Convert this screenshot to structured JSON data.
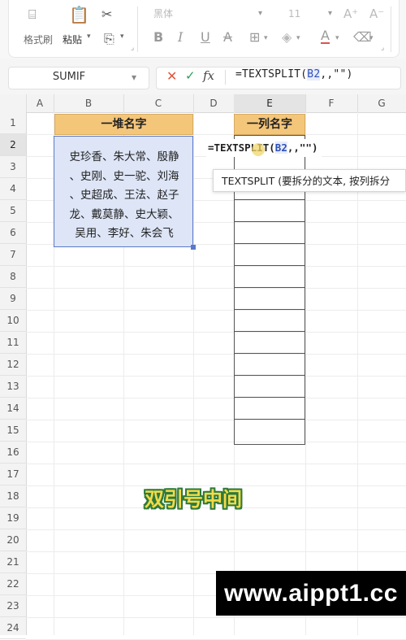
{
  "ribbon": {
    "format_painter_label": "格式刷",
    "paste_label": "粘贴",
    "font_name": "黑体",
    "font_size": "11",
    "increase_font_label": "A⁺",
    "decrease_font_label": "A⁻",
    "bold_label": "B",
    "italic_label": "I",
    "underline_label": "U",
    "strike_label": "A",
    "font_color_label": "A",
    "dropdown_arrow": "▾"
  },
  "formula_bar": {
    "name_box": "SUMIF",
    "fx_label": "fx",
    "cancel_symbol": "✕",
    "confirm_symbol": "✓",
    "formula_prefix": "=TEXTSPLIT(",
    "formula_ref": "B2",
    "formula_suffix": ",,\"\")"
  },
  "sheet": {
    "columns": [
      "A",
      "B",
      "C",
      "D",
      "E",
      "F",
      "G"
    ],
    "rows": [
      "1",
      "2",
      "3",
      "4",
      "5",
      "6",
      "7",
      "8",
      "9",
      "10",
      "11",
      "12",
      "13",
      "14",
      "15",
      "16",
      "17",
      "18",
      "19",
      "20",
      "21",
      "22",
      "23",
      "24"
    ],
    "b1_header": "一堆名字",
    "e1_header": "一列名字",
    "b2_lines": [
      "史珍香、朱大常、殷静",
      "、史刚、史一驼、刘海",
      "、史超成、王法、赵子",
      "龙、戴莫静、史大颖、",
      "吴用、李好、朱会飞"
    ],
    "edit_prefix": "=TEXTSPLIT(",
    "edit_ref": "B2",
    "edit_suffix": ",,\"\")"
  },
  "tooltip": {
    "text": "TEXTSPLIT  (要拆分的文本, 按列拆分"
  },
  "caption": "双引号中间",
  "watermark": "www.aippt1.cc",
  "colors": {
    "header_fill": "#f4c67a",
    "selection_fill": "#dde5f7",
    "selection_border": "#5b79c8",
    "caption_fill": "#f3da4a",
    "caption_outline": "#2d7a3a"
  }
}
